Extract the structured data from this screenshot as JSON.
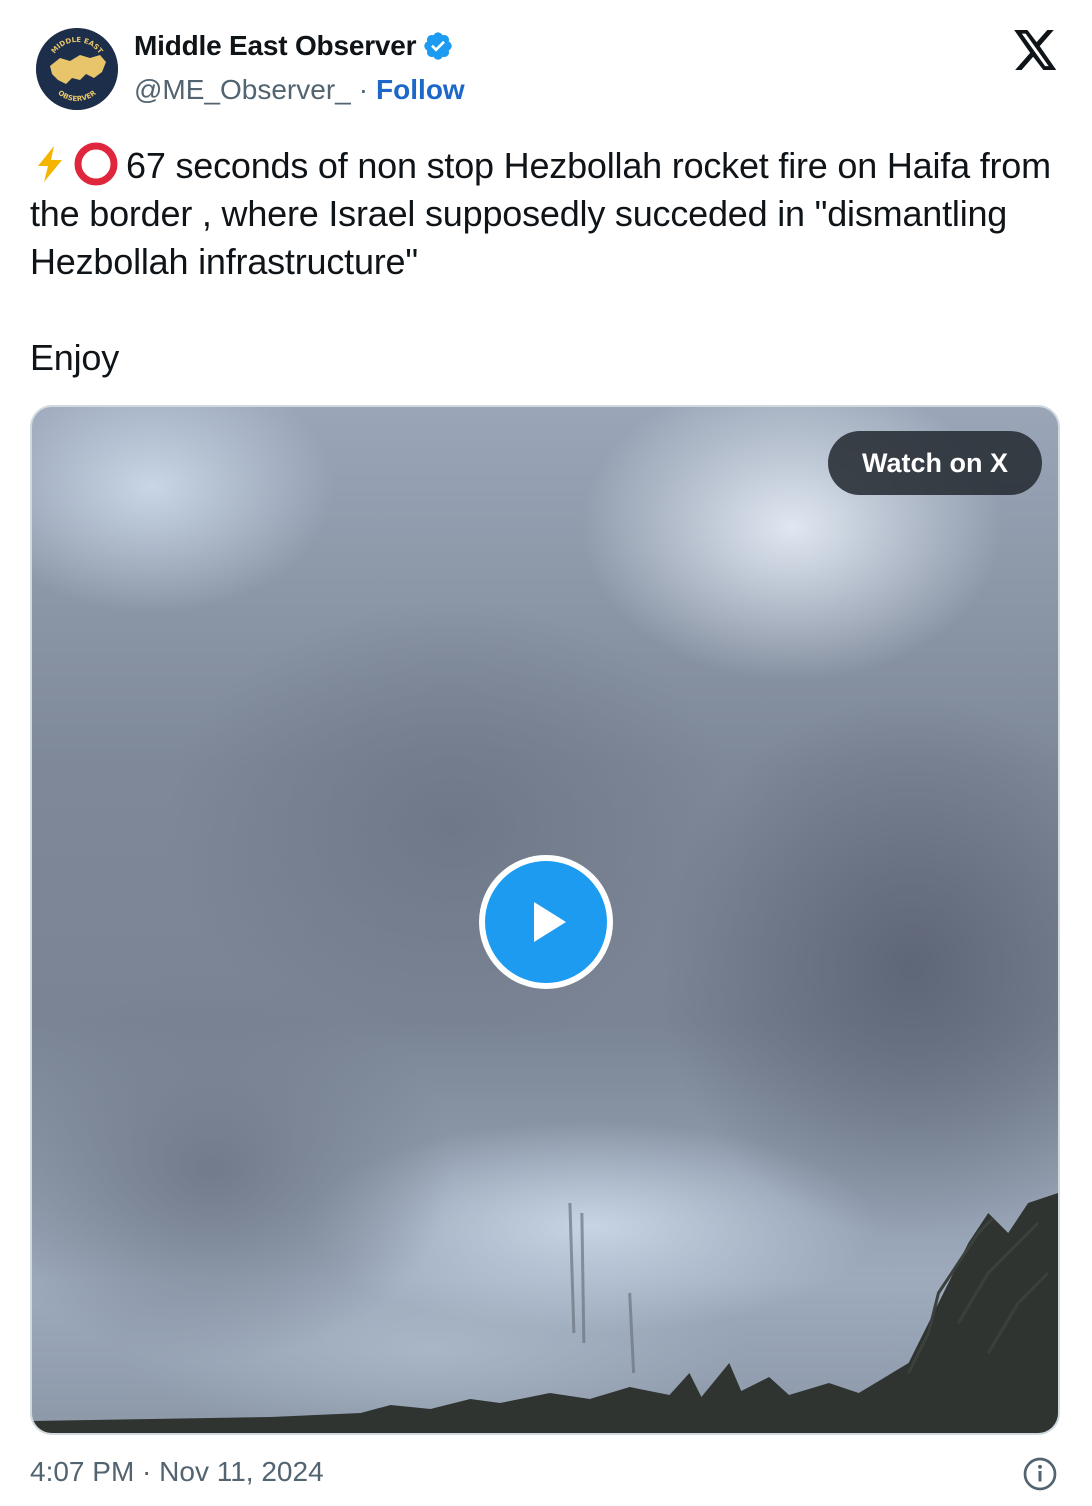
{
  "author": {
    "display_name": "Middle East Observer",
    "handle": "@ME_Observer_",
    "separator": "·",
    "follow_label": "Follow",
    "avatar_text_top": "MIDDLE EAST",
    "avatar_text_bottom": "OBSERVER",
    "verified_icon": "verified-badge-icon"
  },
  "platform_icon": "x-logo-icon",
  "tweet": {
    "emoji": [
      "⚡",
      "⭕"
    ],
    "text": "67 seconds of non stop Hezbollah rocket fire on Haifa from the border , where Israel supposedly succeded in \"dismantling Hezbollah infrastructure\"",
    "text_line2": "Enjoy"
  },
  "media": {
    "watch_label": "Watch on X",
    "play_icon": "play-icon"
  },
  "footer": {
    "timestamp": "4:07 PM · Nov 11, 2024",
    "info_icon": "info-icon"
  },
  "colors": {
    "text": "#0f1419",
    "secondary": "#536471",
    "link": "#1d67c8",
    "verified": "#1d9bf0",
    "play": "#1d9bf0"
  }
}
